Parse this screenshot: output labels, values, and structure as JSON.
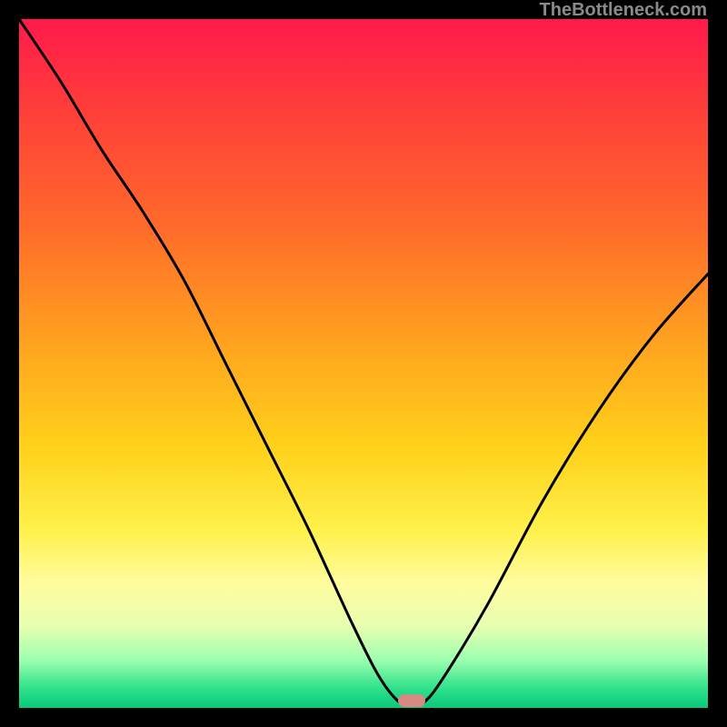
{
  "watermark": "TheBottleneck.com",
  "marker": {
    "x_pct": 57,
    "y_pct": 99
  },
  "chart_data": {
    "type": "line",
    "title": "",
    "xlabel": "",
    "ylabel": "",
    "xlim": [
      0,
      100
    ],
    "ylim": [
      0,
      100
    ],
    "series": [
      {
        "name": "bottleneck-curve",
        "x": [
          0,
          6,
          12,
          18,
          24,
          30,
          36,
          42,
          48,
          52,
          55,
          57,
          59,
          62,
          68,
          76,
          84,
          92,
          100
        ],
        "y": [
          100,
          91,
          81,
          72,
          62,
          50,
          38,
          26,
          13,
          5,
          1,
          0.5,
          1,
          5,
          15,
          30,
          43,
          54,
          63
        ]
      }
    ],
    "annotations": [
      {
        "type": "marker",
        "x": 57,
        "y": 0.5,
        "label": "optimal-point"
      }
    ],
    "background_gradient": {
      "stops": [
        {
          "pct": 0,
          "color": "#ff1a4c"
        },
        {
          "pct": 12,
          "color": "#ff3b3b"
        },
        {
          "pct": 30,
          "color": "#ff6a2a"
        },
        {
          "pct": 48,
          "color": "#ffa61f"
        },
        {
          "pct": 62,
          "color": "#ffd11a"
        },
        {
          "pct": 74,
          "color": "#fff04a"
        },
        {
          "pct": 82,
          "color": "#fffc9e"
        },
        {
          "pct": 88,
          "color": "#e8ffb0"
        },
        {
          "pct": 93,
          "color": "#9effb0"
        },
        {
          "pct": 97,
          "color": "#32e28c"
        },
        {
          "pct": 100,
          "color": "#08c97a"
        }
      ]
    }
  }
}
